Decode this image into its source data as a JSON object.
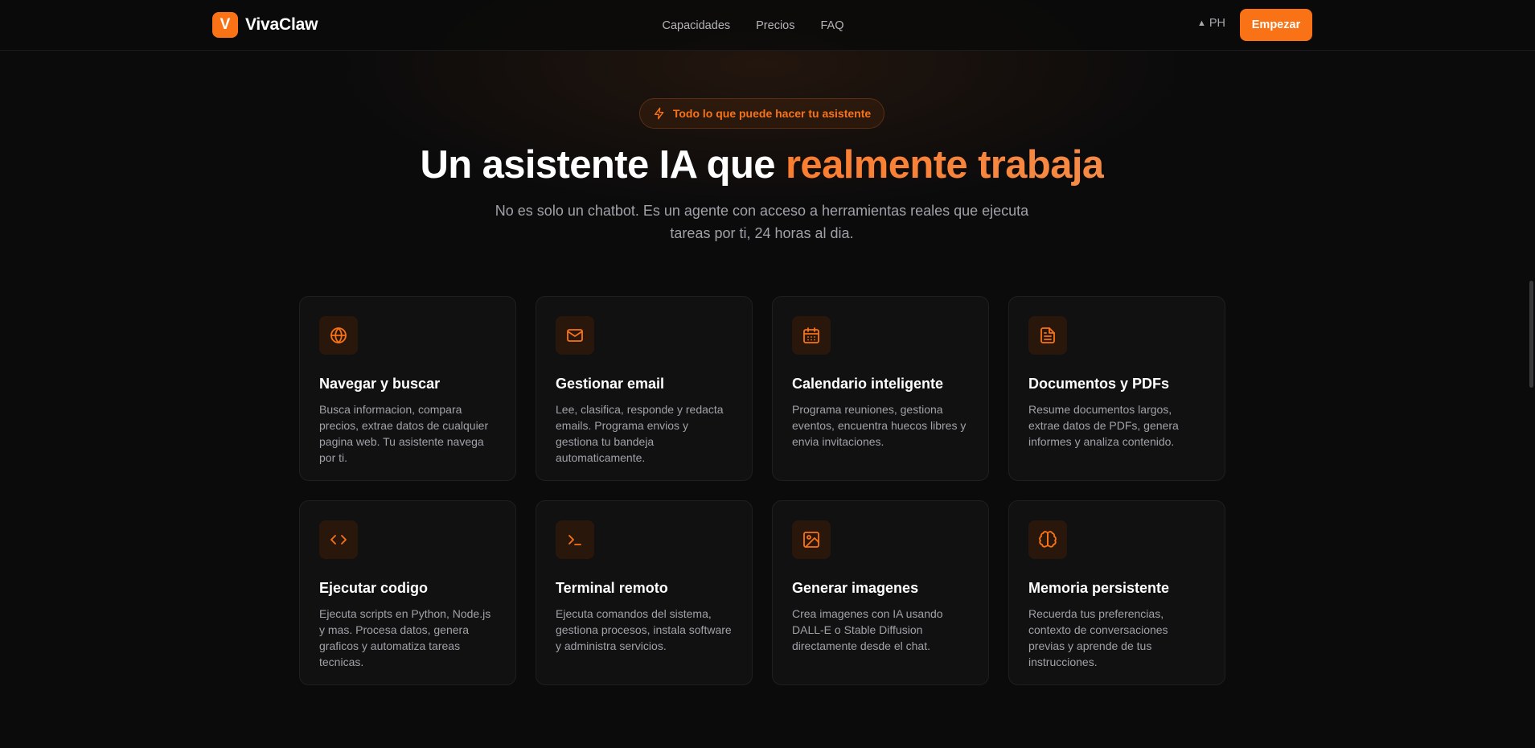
{
  "header": {
    "brand_letter": "V",
    "brand_name": "VivaClaw",
    "nav": [
      "Capacidades",
      "Precios",
      "FAQ"
    ],
    "ph_label": "PH",
    "cta_label": "Empezar"
  },
  "hero": {
    "badge": "Todo lo que puede hacer tu asistente",
    "headline_plain": "Un asistente IA que ",
    "headline_accent": "realmente trabaja",
    "subtitle": "No es solo un chatbot. Es un agente con acceso a herramientas reales que ejecuta tareas por ti, 24 horas al dia."
  },
  "features": [
    {
      "icon": "globe-icon",
      "title": "Navegar y buscar",
      "desc": "Busca informacion, compara precios, extrae datos de cualquier pagina web. Tu asistente navega por ti."
    },
    {
      "icon": "mail-icon",
      "title": "Gestionar email",
      "desc": "Lee, clasifica, responde y redacta emails. Programa envios y gestiona tu bandeja automaticamente."
    },
    {
      "icon": "calendar-icon",
      "title": "Calendario inteligente",
      "desc": "Programa reuniones, gestiona eventos, encuentra huecos libres y envia invitaciones."
    },
    {
      "icon": "document-icon",
      "title": "Documentos y PDFs",
      "desc": "Resume documentos largos, extrae datos de PDFs, genera informes y analiza contenido."
    },
    {
      "icon": "code-icon",
      "title": "Ejecutar codigo",
      "desc": "Ejecuta scripts en Python, Node.js y mas. Procesa datos, genera graficos y automatiza tareas tecnicas."
    },
    {
      "icon": "terminal-icon",
      "title": "Terminal remoto",
      "desc": "Ejecuta comandos del sistema, gestiona procesos, instala software y administra servicios."
    },
    {
      "icon": "image-icon",
      "title": "Generar imagenes",
      "desc": "Crea imagenes con IA usando DALL-E o Stable Diffusion directamente desde el chat."
    },
    {
      "icon": "brain-icon",
      "title": "Memoria persistente",
      "desc": "Recuerda tus preferencias, contexto de conversaciones previas y aprende de tus instrucciones."
    }
  ],
  "colors": {
    "accent": "#f97316",
    "background": "#0b0b0c",
    "card": "#111112"
  }
}
